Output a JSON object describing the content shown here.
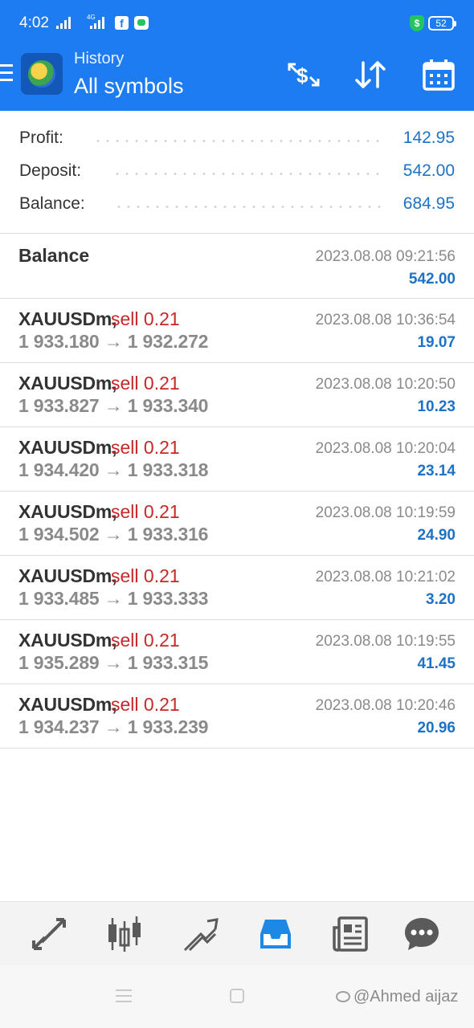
{
  "status_bar": {
    "time": "4:02",
    "network_label": "4G",
    "battery": "52",
    "shield_glyph": "$",
    "fb_glyph": "f"
  },
  "header": {
    "title": "History",
    "subtitle": "All symbols",
    "icons": [
      "menu-icon",
      "app-logo",
      "currency-swap-icon",
      "sort-icon",
      "calendar-icon"
    ]
  },
  "summary": [
    {
      "label": "Profit:",
      "value": "142.95"
    },
    {
      "label": "Deposit:",
      "value": "542.00"
    },
    {
      "label": "Balance:",
      "value": "684.95"
    }
  ],
  "balance_entry": {
    "title": "Balance",
    "time": "2023.08.08 09:21:56",
    "amount": "542.00"
  },
  "deals": [
    {
      "symbol": "XAUUSDm,",
      "type": "sell 0.21",
      "open": "1 933.180",
      "arrow": "→",
      "close": "1 932.272",
      "time": "2023.08.08 10:36:54",
      "profit": "19.07"
    },
    {
      "symbol": "XAUUSDm,",
      "type": "sell 0.21",
      "open": "1 933.827",
      "arrow": "→",
      "close": "1 933.340",
      "time": "2023.08.08 10:20:50",
      "profit": "10.23"
    },
    {
      "symbol": "XAUUSDm,",
      "type": "sell 0.21",
      "open": "1 934.420",
      "arrow": "→",
      "close": "1 933.318",
      "time": "2023.08.08 10:20:04",
      "profit": "23.14"
    },
    {
      "symbol": "XAUUSDm,",
      "type": "sell 0.21",
      "open": "1 934.502",
      "arrow": "→",
      "close": "1 933.316",
      "time": "2023.08.08 10:19:59",
      "profit": "24.90"
    },
    {
      "symbol": "XAUUSDm,",
      "type": "sell 0.21",
      "open": "1 933.485",
      "arrow": "→",
      "close": "1 933.333",
      "time": "2023.08.08 10:21:02",
      "profit": "3.20"
    },
    {
      "symbol": "XAUUSDm,",
      "type": "sell 0.21",
      "open": "1 935.289",
      "arrow": "→",
      "close": "1 933.315",
      "time": "2023.08.08 10:19:55",
      "profit": "41.45"
    },
    {
      "symbol": "XAUUSDm,",
      "type": "sell 0.21",
      "open": "1 934.237",
      "arrow": "→",
      "close": "1 933.239",
      "time": "2023.08.08 10:20:46",
      "profit": "20.96"
    }
  ],
  "bottom_nav": {
    "items": [
      "quotes-icon",
      "chart-icon",
      "trade-icon",
      "history-icon",
      "news-icon",
      "messages-icon"
    ],
    "active": "history-icon",
    "active_color": "#1e88e5",
    "inactive_color": "#5a5a5a"
  },
  "system_nav": {
    "watermark": "@Ahmed aijaz"
  },
  "colors": {
    "app_bar": "#1e7cf2",
    "profit": "#1e72c6",
    "sell": "#c62828"
  }
}
